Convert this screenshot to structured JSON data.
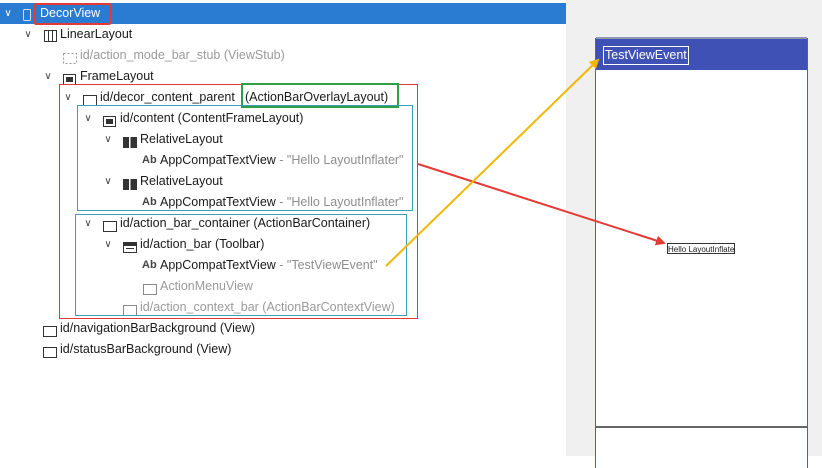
{
  "tree": {
    "root": {
      "label": "DecorView",
      "icon": "phone-icon"
    },
    "linear_layout": {
      "label": "LinearLayout"
    },
    "action_mode_bar_stub": {
      "label": "id/action_mode_bar_stub (ViewStub)"
    },
    "frame_layout": {
      "label": "FrameLayout"
    },
    "decor_content_parent": {
      "id": "id/decor_content_parent ",
      "type": "(ActionBarOverlayLayout)"
    },
    "content": {
      "label": "id/content (ContentFrameLayout)"
    },
    "relative_layout_1": {
      "label": "RelativeLayout"
    },
    "text_view_1": {
      "ab": "Ab",
      "name": "AppCompatTextView",
      "sep": " - ",
      "text": "\"Hello LayoutInflater\""
    },
    "relative_layout_2": {
      "label": "RelativeLayout"
    },
    "text_view_2": {
      "ab": "Ab",
      "name": "AppCompatTextView",
      "sep": " - ",
      "text": "\"Hello LayoutInflater\""
    },
    "action_bar_container": {
      "label": "id/action_bar_container (ActionBarContainer)"
    },
    "action_bar": {
      "label": "id/action_bar (Toolbar)"
    },
    "text_view_3": {
      "ab": "Ab",
      "name": "AppCompatTextView",
      "sep": " - ",
      "text": "\"TestViewEvent\""
    },
    "action_menu_view": {
      "label": "ActionMenuView"
    },
    "action_context_bar": {
      "label": "id/action_context_bar (ActionBarContextView)"
    },
    "navigation_bar_background": {
      "label": "id/navigationBarBackground (View)"
    },
    "status_bar_background": {
      "label": "id/statusBarBackground (View)"
    }
  },
  "preview": {
    "action_bar_title": "TestViewEvent",
    "hello_text": "Hello LayoutInflater"
  },
  "colors": {
    "selection": "#2a7bd2",
    "annotation_red": "#e53935",
    "annotation_green": "#2ea043",
    "annotation_teal": "#3aa0b8",
    "annotation_orange": "#f2b705",
    "action_bar": "#3f51b5"
  }
}
